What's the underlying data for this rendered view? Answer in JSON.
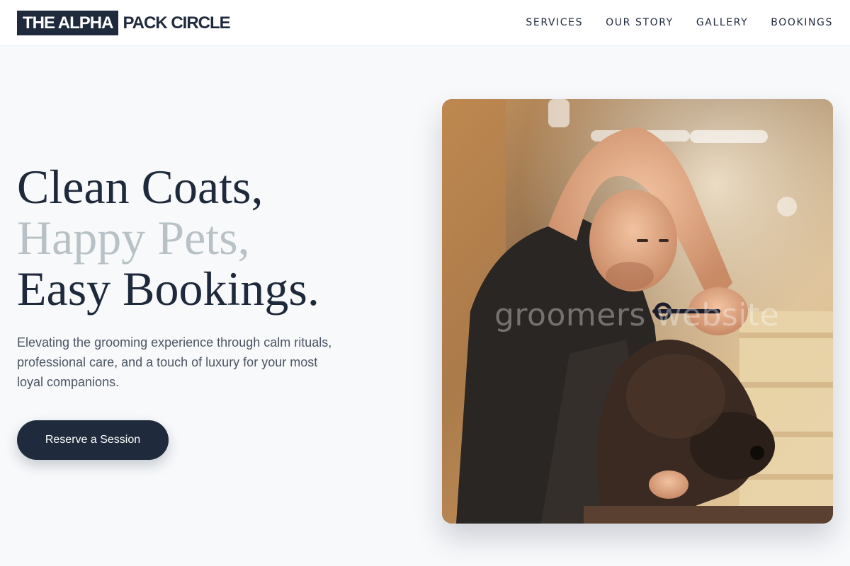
{
  "brand": {
    "name_boxed": "THE ALPHA",
    "name_rest": "PACK CIRCLE",
    "color": "#1f2a3d"
  },
  "nav": {
    "items": [
      {
        "label": "SERVICES"
      },
      {
        "label": "OUR STORY"
      },
      {
        "label": "GALLERY"
      },
      {
        "label": "BOOKINGS"
      }
    ]
  },
  "hero": {
    "headline_line1": "Clean Coats,",
    "headline_line2": "Happy Pets,",
    "headline_line3": "Easy Bookings.",
    "accent_color": "#b8c2c6",
    "subtext": "Elevating the grooming experience through calm rituals, professional care, and a touch of luxury for your most loyal companions.",
    "cta_label": "Reserve a Session"
  },
  "photo": {
    "watermark": "groomers website",
    "subject": "groomer trimming a dark-coated dog with scissors"
  }
}
